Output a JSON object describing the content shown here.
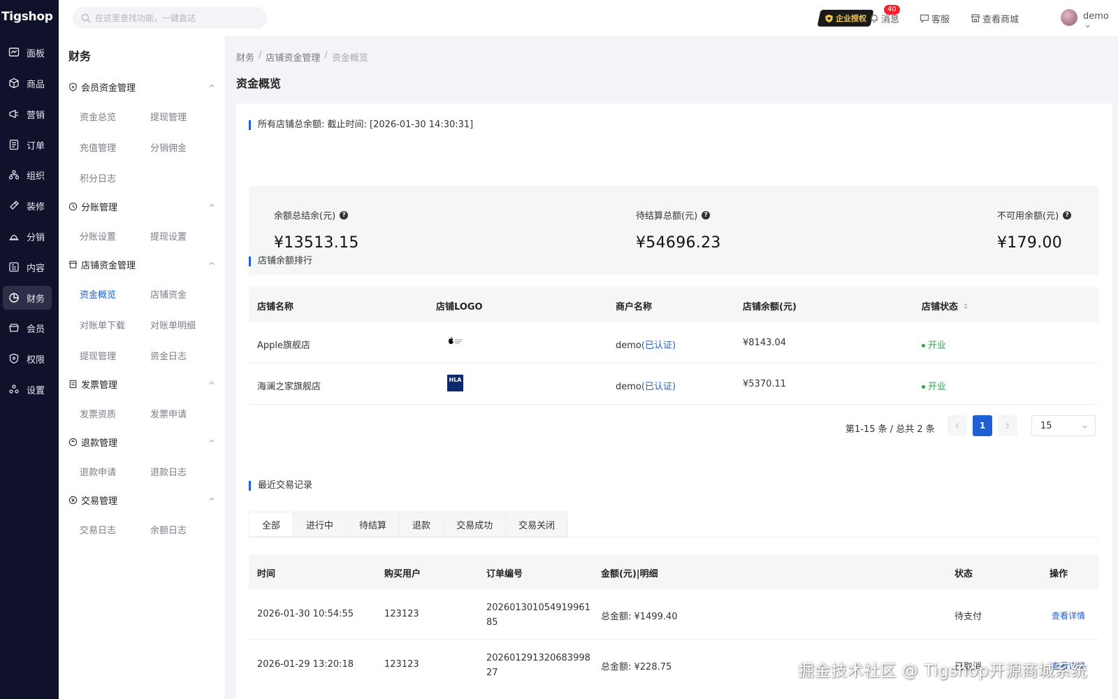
{
  "app": {
    "logo": "Tigshop"
  },
  "rail": [
    {
      "label": "面板",
      "icon": "dashboard-icon"
    },
    {
      "label": "商品",
      "icon": "cube-icon"
    },
    {
      "label": "营销",
      "icon": "marketing-icon"
    },
    {
      "label": "订单",
      "icon": "order-icon"
    },
    {
      "label": "组织",
      "icon": "org-icon"
    },
    {
      "label": "装修",
      "icon": "brush-icon"
    },
    {
      "label": "分销",
      "icon": "distribution-icon"
    },
    {
      "label": "内容",
      "icon": "content-icon"
    },
    {
      "label": "财务",
      "icon": "finance-icon",
      "active": true
    },
    {
      "label": "会员",
      "icon": "member-icon"
    },
    {
      "label": "权限",
      "icon": "permission-icon"
    },
    {
      "label": "设置",
      "icon": "settings-icon"
    }
  ],
  "topbar": {
    "search_placeholder": "在这里查找功能，一键直达",
    "enterprise_badge": "企业授权",
    "messages_label": "消息",
    "messages_count": "40",
    "service_label": "客服",
    "view_store_label": "查看商城",
    "user_name": "demo"
  },
  "subside": {
    "title": "财务",
    "groups": [
      {
        "label": "会员资金管理",
        "items": [
          "资金总览",
          "提现管理",
          "充值管理",
          "分销佣金",
          "积分日志"
        ]
      },
      {
        "label": "分账管理",
        "items": [
          "分账设置",
          "提现设置"
        ]
      },
      {
        "label": "店铺资金管理",
        "items": [
          "资金概览",
          "店铺资金",
          "对账单下载",
          "对账单明细",
          "提现管理",
          "资金日志"
        ]
      },
      {
        "label": "发票管理",
        "items": [
          "发票资质",
          "发票申请"
        ]
      },
      {
        "label": "退款管理",
        "items": [
          "退款申请",
          "退款日志"
        ]
      },
      {
        "label": "交易管理",
        "items": [
          "交易日志",
          "余额日志"
        ]
      }
    ]
  },
  "breadcrumb": [
    "财务",
    "店铺资金管理",
    "资金概览"
  ],
  "page_title": "资金概览",
  "summary": {
    "title": "所有店铺总余额: 截止时间: [2026-01-30 14:30:31]",
    "stats": [
      {
        "label": "余额总结余(元)",
        "value": "¥13513.15"
      },
      {
        "label": "待结算总额(元)",
        "value": "¥54696.23"
      },
      {
        "label": "不可用余额(元)",
        "value": "¥179.00"
      }
    ]
  },
  "ranking": {
    "title": "店铺余额排行",
    "columns": [
      "店铺名称",
      "店铺LOGO",
      "商户名称",
      "店铺余额(元)",
      "店铺状态"
    ],
    "rows": [
      {
        "shop": "Apple旗舰店",
        "logo": "apple-logo",
        "merchant": "demo",
        "verified": "(已认证)",
        "balance": "¥8143.04",
        "status": "开业"
      },
      {
        "shop": "海澜之家旗舰店",
        "logo": "HLA",
        "merchant": "demo",
        "verified": "(已认证)",
        "balance": "¥5370.11",
        "status": "开业"
      }
    ],
    "pager": {
      "info": "第1-15 条 / 总共 2 条",
      "current": "1",
      "page_size": "15"
    }
  },
  "transactions": {
    "title": "最近交易记录",
    "tabs": [
      "全部",
      "进行中",
      "待结算",
      "退款",
      "交易成功",
      "交易关闭"
    ],
    "columns": [
      "时间",
      "购买用户",
      "订单编号",
      "金额(元)|明细",
      "状态",
      "操作"
    ],
    "rows": [
      {
        "time": "2026-01-30 10:54:55",
        "user": "123123",
        "order_no_1": "202601301054919961",
        "order_no_2": "85",
        "amount": "总金额: ¥1499.40",
        "status": "待支付",
        "action": "查看详情"
      },
      {
        "time": "2026-01-29 13:20:18",
        "user": "123123",
        "order_no_1": "202601291320683998",
        "order_no_2": "27",
        "amount": "总金额: ¥228.75",
        "status": "已取消",
        "action": "查看详情"
      }
    ]
  },
  "watermark": "掘金技术社区 @ Tigshop开源商城系统",
  "colors": {
    "rail_bg": "#10112b",
    "accent": "#1f5fd6",
    "success": "#2ba34a",
    "badge": "#f5222d"
  }
}
